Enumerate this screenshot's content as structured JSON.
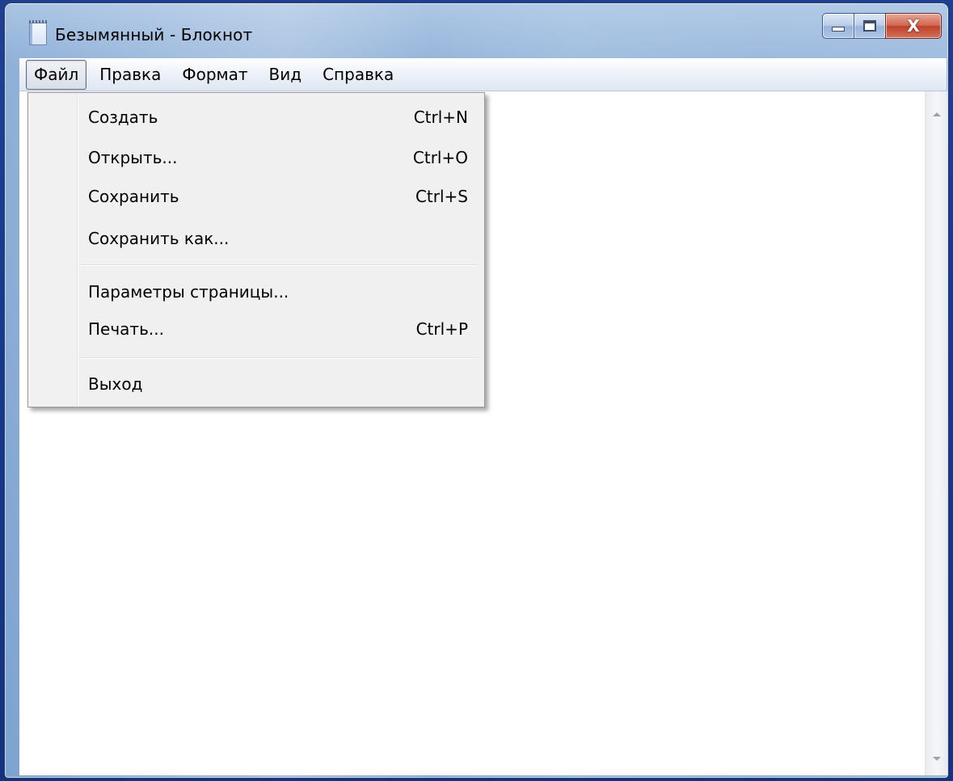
{
  "window": {
    "title": "Безымянный - Блокнот",
    "icon": "notepad-icon",
    "caption_buttons": {
      "minimize": "minimize-icon",
      "maximize": "maximize-icon",
      "close": "X"
    },
    "close_color": "#c7432c"
  },
  "menubar": {
    "items": [
      {
        "label": "Файл",
        "active": true
      },
      {
        "label": "Правка"
      },
      {
        "label": "Формат"
      },
      {
        "label": "Вид"
      },
      {
        "label": "Справка"
      }
    ]
  },
  "file_menu": {
    "items": [
      {
        "label": "Создать",
        "shortcut": "Ctrl+N"
      },
      {
        "label": "Открыть...",
        "shortcut": "Ctrl+O"
      },
      {
        "label": "Сохранить",
        "shortcut": "Ctrl+S"
      },
      {
        "label": "Сохранить как...",
        "shortcut": ""
      },
      {
        "label": "Параметры страницы...",
        "shortcut": ""
      },
      {
        "label": "Печать...",
        "shortcut": "Ctrl+P"
      },
      {
        "label": "Выход",
        "shortcut": ""
      }
    ]
  },
  "editor": {
    "content": ""
  }
}
